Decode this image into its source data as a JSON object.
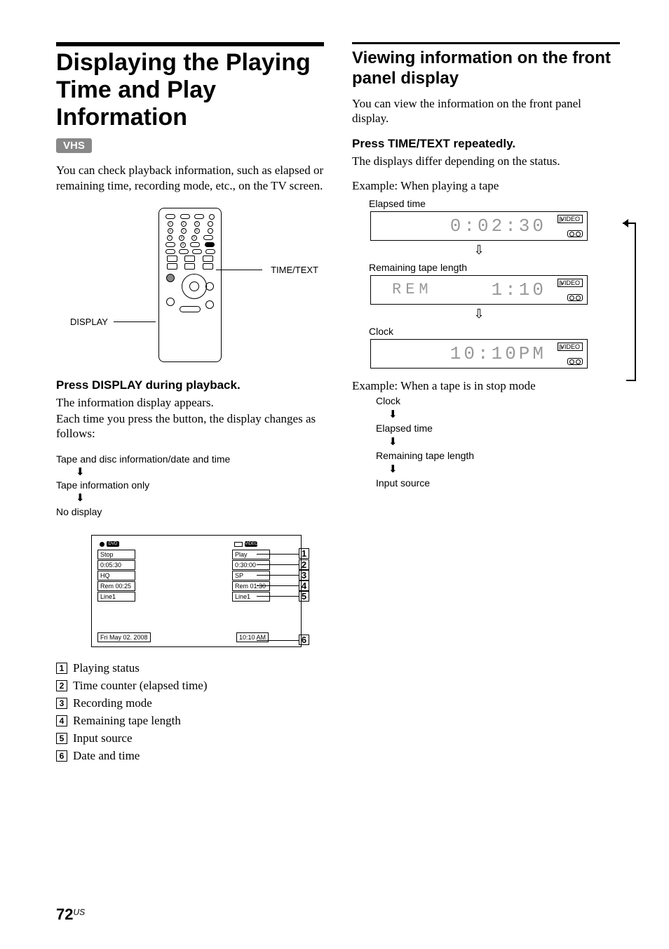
{
  "left": {
    "title": "Displaying the Playing Time and Play Information",
    "badge": "VHS",
    "intro": "You can check playback information, such as elapsed or remaining time, recording mode, etc., on the TV screen.",
    "remote": {
      "display_label": "DISPLAY",
      "timetext_label": "TIME/TEXT"
    },
    "press_heading": "Press DISPLAY during playback.",
    "press_body1": "The information display appears.",
    "press_body2": "Each time you press the button, the display changes as follows:",
    "toggle": {
      "a": "Tape and disc information/date and time",
      "b": "Tape information only",
      "c": "No display"
    },
    "osd": {
      "dvd_status": "Stop",
      "dvd_time": "0:05:30",
      "dvd_mode": "HQ",
      "dvd_rem": "Rem 00:25",
      "dvd_line": "Line1",
      "vid_status": "Play",
      "vid_time": "0:30:00",
      "vid_mode": "SP",
      "vid_rem": "Rem 01:30",
      "vid_line": "Line1",
      "date": "Fri May 02. 2008",
      "clock": "10:10 AM"
    },
    "legend": {
      "1": "Playing status",
      "2": "Time counter (elapsed time)",
      "3": "Recording mode",
      "4": "Remaining tape length",
      "5": "Input source",
      "6": "Date and time"
    }
  },
  "right": {
    "title": "Viewing information on the front panel display",
    "intro": "You can view the information on the front panel display.",
    "press_heading": "Press TIME/TEXT repeatedly.",
    "press_body": "The displays differ depending on the status.",
    "example1_label": "Example: When playing a tape",
    "lcd1_label": "Elapsed time",
    "lcd1_value": "0:02:30",
    "lcd2_label": "Remaining tape length",
    "lcd2_prefix": "REM",
    "lcd2_value": "1:10",
    "lcd3_label": "Clock",
    "lcd3_value": "10:10PM",
    "example2_label": "Example: When a tape is in stop mode",
    "cycle": {
      "a": "Clock",
      "b": "Elapsed time",
      "c": "Remaining tape length",
      "d": "Input source"
    },
    "video_tag": "VIDEO"
  },
  "page": {
    "num": "72",
    "suffix": "US"
  }
}
